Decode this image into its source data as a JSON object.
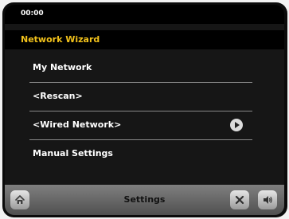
{
  "status": {
    "time": "00:00"
  },
  "header": {
    "title": "Network Wizard"
  },
  "menu": {
    "items": [
      {
        "label": "My Network"
      },
      {
        "label": "<Rescan>"
      },
      {
        "label": "<Wired Network>"
      },
      {
        "label": "Manual Settings"
      }
    ]
  },
  "footer": {
    "label": "Settings"
  },
  "colors": {
    "title": "#f2c21b"
  },
  "icons": {
    "home": "home-icon",
    "close": "close-icon",
    "volume": "volume-icon",
    "chevron": "chevron-right-icon"
  }
}
